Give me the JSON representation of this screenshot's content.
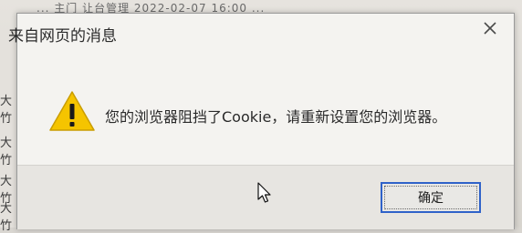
{
  "background": {
    "top_text": "...  主门  让台管理    2022-02-07 16:00   ...",
    "left_glyphs": [
      "大竹",
      "大竹",
      "大竹",
      "大竹"
    ]
  },
  "dialog": {
    "title": "来自网页的消息",
    "message": "您的浏览器阻挡了Cookie，请重新设置您的浏览器。",
    "icon": "warning-icon",
    "ok_label": "确定",
    "accent_color": "#2f62c9",
    "warning_color": "#f5c400"
  }
}
